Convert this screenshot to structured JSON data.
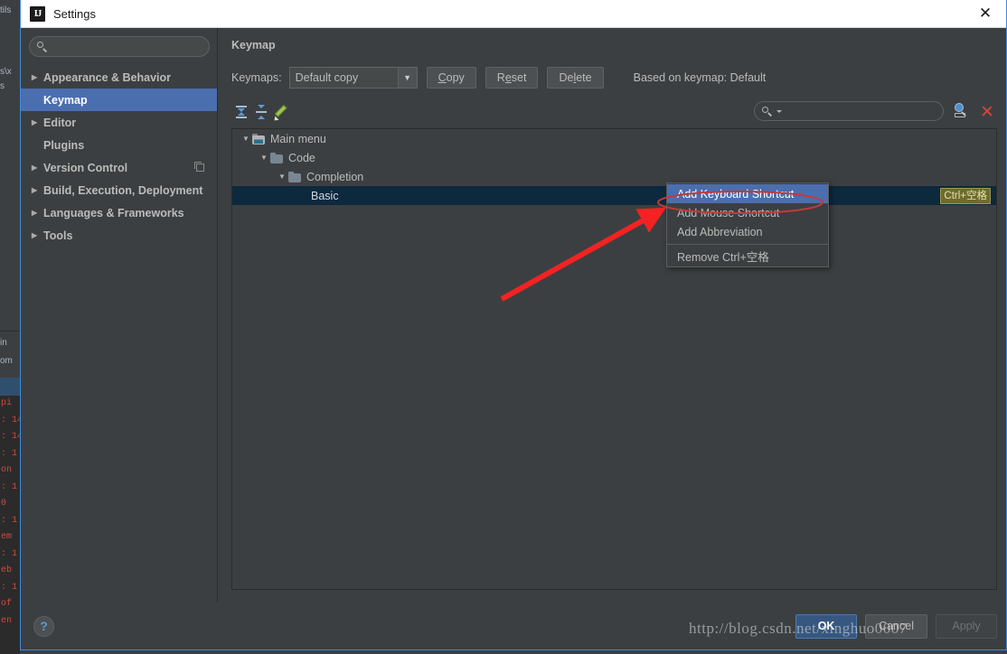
{
  "window": {
    "title": "Settings",
    "app_icon": "intellij-idea-icon",
    "close_icon": "close-icon"
  },
  "sidebar": {
    "search": {
      "value": "",
      "placeholder": "",
      "icon": "search-icon"
    },
    "items": [
      {
        "label": "Appearance & Behavior",
        "expandable": true,
        "selected": false,
        "bold": true
      },
      {
        "label": "Keymap",
        "expandable": false,
        "selected": true,
        "bold": true
      },
      {
        "label": "Editor",
        "expandable": true,
        "selected": false,
        "bold": true
      },
      {
        "label": "Plugins",
        "expandable": false,
        "selected": false,
        "bold": true
      },
      {
        "label": "Version Control",
        "expandable": true,
        "selected": false,
        "bold": true,
        "badge": true
      },
      {
        "label": "Build, Execution, Deployment",
        "expandable": true,
        "selected": false,
        "bold": true
      },
      {
        "label": "Languages & Frameworks",
        "expandable": true,
        "selected": false,
        "bold": true
      },
      {
        "label": "Tools",
        "expandable": true,
        "selected": false,
        "bold": true
      }
    ]
  },
  "pane": {
    "title": "Keymap",
    "keymaps_label": "Keymaps:",
    "keymap_selected": "Default copy",
    "buttons": {
      "copy": "Copy",
      "reset": "Reset",
      "delete": "Delete"
    },
    "based_on": "Based on keymap: Default",
    "toolbar": {
      "expand_all": "expand-all-icon",
      "collapse_all": "collapse-all-icon",
      "edit": "edit-pencil-icon"
    },
    "find": {
      "value": "",
      "placeholder": "",
      "icon": "search-icon",
      "find_by_shortcut_icon": "find-by-shortcut-icon",
      "clear_icon": "clear-red-x-icon"
    }
  },
  "tree": {
    "rows": [
      {
        "label": "Main menu",
        "depth": 0,
        "expanded": true,
        "icon": "main-menu-folder-icon",
        "selected": false,
        "shortcut": ""
      },
      {
        "label": "Code",
        "depth": 1,
        "expanded": true,
        "icon": "folder-icon",
        "selected": false,
        "shortcut": ""
      },
      {
        "label": "Completion",
        "depth": 2,
        "expanded": true,
        "icon": "folder-icon",
        "selected": false,
        "shortcut": ""
      },
      {
        "label": "Basic",
        "depth": 3,
        "expanded": null,
        "icon": "",
        "selected": true,
        "shortcut": "Ctrl+空格"
      }
    ]
  },
  "context_menu": {
    "items": [
      {
        "label": "Add Keyboard Shortcut",
        "highlighted": true,
        "separator_before": false
      },
      {
        "label": "Add Mouse Shortcut",
        "highlighted": false,
        "separator_before": false
      },
      {
        "label": "Add Abbreviation",
        "highlighted": false,
        "separator_before": false
      },
      {
        "label": "Remove Ctrl+空格",
        "highlighted": false,
        "separator_before": true
      }
    ]
  },
  "bottom": {
    "help_label": "?",
    "ok": "OK",
    "cancel": "Cancel",
    "apply": "Apply"
  },
  "annotations": {
    "arrow_color": "#f42222",
    "ellipse_color": "#c03a3a",
    "watermark": "http://blog.csdn.net/xinghuo0007"
  },
  "background": {
    "top_fragments": [
      "tils",
      "",
      "s\\x",
      "s"
    ],
    "tool_labels": [
      "in",
      "om"
    ],
    "console_lines": [
      "pi",
      ": 14",
      ": 14",
      ": 1",
      "on",
      ": 1",
      "0",
      ": 1",
      "em",
      ": 1",
      "eb",
      ": 1",
      "of",
      "en"
    ]
  },
  "colors": {
    "accent": "#4b6eaf",
    "dialog_bg": "#3c3f41",
    "tree_selection": "#0d293e",
    "shortcut_badge_bg": "#6f6b2d",
    "primary_button": "#365880"
  }
}
